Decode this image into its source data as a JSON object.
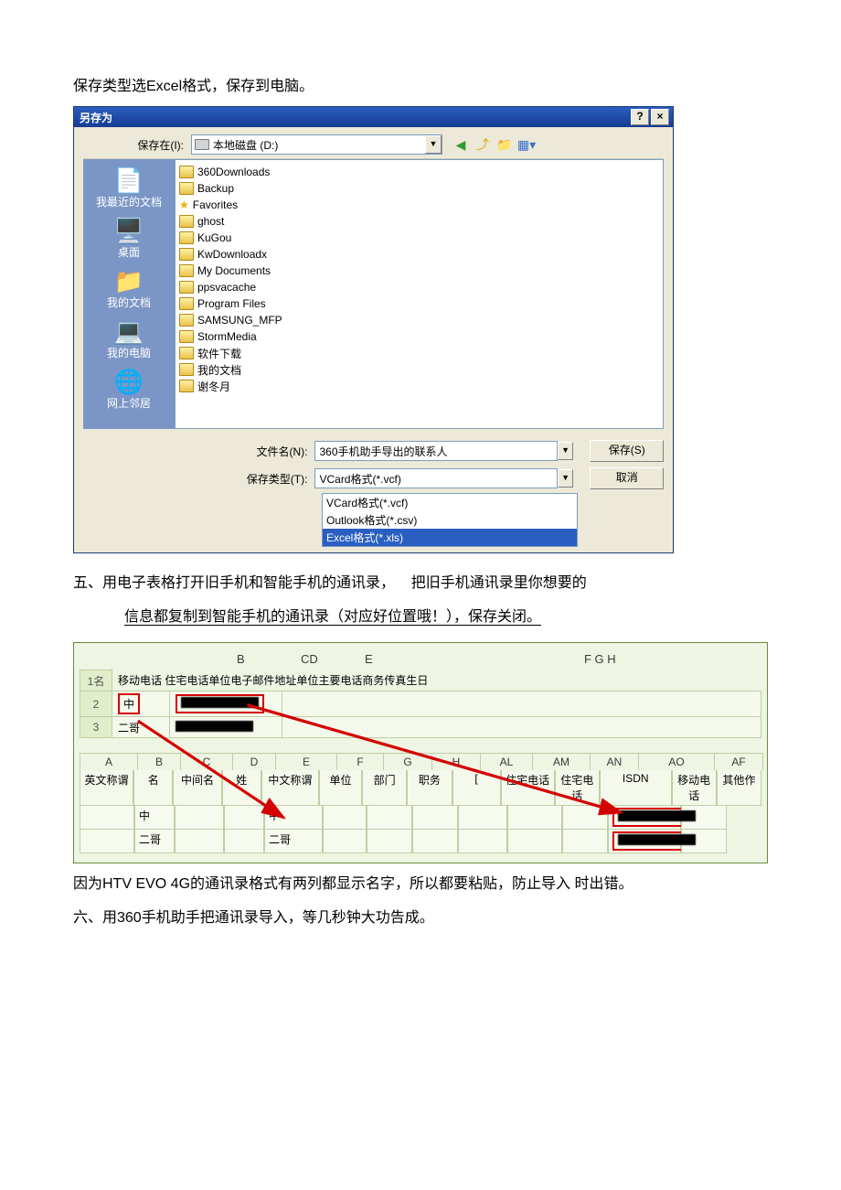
{
  "intro_line": "保存类型选Excel格式，保存到电脑。",
  "dialog": {
    "title": "另存为",
    "help_btn": "?",
    "close_btn": "×",
    "save_in_label": "保存在(I):",
    "save_in_value": "本地磁盘 (D:)",
    "folders": [
      "360Downloads",
      "Backup",
      "Favorites",
      "ghost",
      "KuGou",
      "KwDownloadx",
      "My Documents",
      "ppsvacache",
      "Program Files",
      "SAMSUNG_MFP",
      "StormMedia",
      "软件下载",
      "我的文档",
      "谢冬月"
    ],
    "places": [
      {
        "icon": "📄",
        "label": "我最近的文档"
      },
      {
        "icon": "🖥️",
        "label": "桌面"
      },
      {
        "icon": "📁",
        "label": "我的文档"
      },
      {
        "icon": "💻",
        "label": "我的电脑"
      },
      {
        "icon": "🌐",
        "label": "网上邻居"
      }
    ],
    "filename_label": "文件名(N):",
    "filename_value": "360手机助手导出的联系人",
    "filetype_label": "保存类型(T):",
    "filetype_value": "VCard格式(*.vcf)",
    "filetype_options": [
      "VCard格式(*.vcf)",
      "Outlook格式(*.csv)",
      "Excel格式(*.xls)"
    ],
    "save_btn": "保存(S)",
    "cancel_btn": "取消"
  },
  "step5_a": "五、用电子表格打开旧手机和智能手机的通讯录，",
  "step5_b": "把旧手机通讯录里你想要的",
  "step5_c": "信息都复制到智能手机的通讯录（对应好位置哦！），保存关闭。",
  "sheet1": {
    "col_marks": {
      "B": "B",
      "CD": "CD",
      "E": "E",
      "FGH": "F G H"
    },
    "header_line": "移动电话 住宅电话单位电子邮件地址单位主要电话商务传真生日",
    "row1_label": "1名",
    "rows": [
      "中",
      "二哥"
    ]
  },
  "sheet2": {
    "col_letters": [
      "A",
      "B",
      "C",
      "D",
      "E",
      "F",
      "G",
      "H",
      "AL",
      "AM",
      "AN",
      "AO",
      "AF"
    ],
    "col_labels": [
      "英文称谓",
      "名",
      "中间名",
      "姓",
      "中文称谓",
      "单位",
      "部门",
      "职务",
      "[",
      "住宅电话",
      "住宅电话",
      "ISDN",
      "移动电话",
      "其他作"
    ],
    "rows": [
      {
        "name": "中",
        "cn": "中"
      },
      {
        "name": "二哥",
        "cn": "二哥"
      }
    ]
  },
  "note1": "因为HTV EVO 4G的通讯录格式有两列都显示名字，所以都要粘贴，防止导入 时出错。",
  "note2": "六、用360手机助手把通讯录导入，等几秒钟大功告成。"
}
